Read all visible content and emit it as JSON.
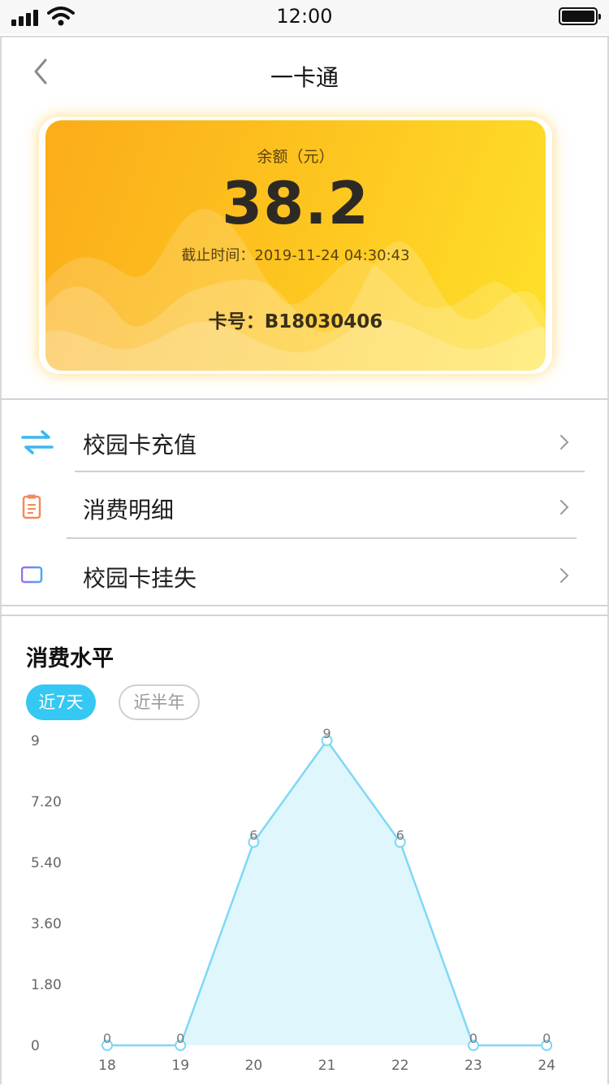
{
  "status_bar": {
    "time": "12:00"
  },
  "nav": {
    "title": "一卡通"
  },
  "card": {
    "balance_label": "余额（元）",
    "balance": "38.2",
    "deadline": "截止时间：2019-11-24 04:30:43",
    "card_number": "卡号：B18030406"
  },
  "menu": [
    {
      "label": "校园卡充值",
      "icon": "transfer-arrows-icon"
    },
    {
      "label": "消费明细",
      "icon": "clipboard-icon"
    },
    {
      "label": "校园卡挂失",
      "icon": "card-icon"
    }
  ],
  "consumption": {
    "title": "消费水平",
    "tabs": [
      {
        "label": "近7天",
        "active": true
      },
      {
        "label": "近半年",
        "active": false
      }
    ]
  },
  "colors": {
    "accent": "#34c8f2",
    "line": "#7fd8f5",
    "area": "#dff6fc"
  },
  "chart_data": {
    "type": "area",
    "x": [
      "18",
      "19",
      "20",
      "21",
      "22",
      "23",
      "24"
    ],
    "values": [
      0,
      0,
      6,
      9,
      6,
      0,
      0
    ],
    "data_labels": [
      "0",
      "0",
      "6",
      "9",
      "6",
      "0",
      "0"
    ],
    "y_ticks": [
      "0",
      "1.80",
      "3.60",
      "5.40",
      "7.20",
      "9"
    ],
    "ylim": [
      0,
      9
    ],
    "grid": false
  }
}
